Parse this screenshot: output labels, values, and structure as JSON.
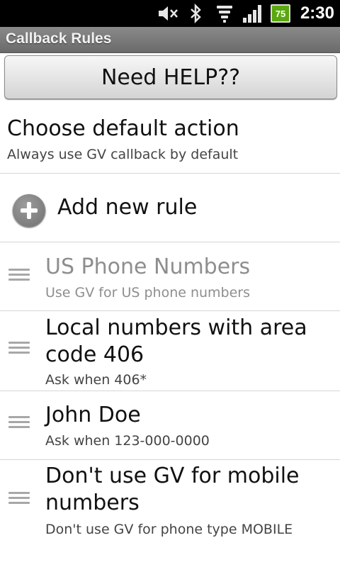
{
  "status_bar": {
    "icons": [
      "mute-icon",
      "bluetooth-icon",
      "wifi-icon",
      "signal-icon"
    ],
    "battery_level": "75",
    "time": "2:30"
  },
  "app": {
    "title": "Callback Rules"
  },
  "help_button": {
    "label": "Need HELP??"
  },
  "default_action": {
    "title": "Choose default action",
    "summary": "Always use GV callback by default"
  },
  "add_rule": {
    "label": "Add new rule",
    "icon": "add-circle-icon"
  },
  "rules": [
    {
      "title": "US Phone Numbers",
      "summary": "Use GV for US phone numbers",
      "enabled": false
    },
    {
      "title": "Local numbers with area code 406",
      "summary": "Ask when 406*",
      "enabled": true
    },
    {
      "title": "John Doe",
      "summary": "Ask when 123-000-0000",
      "enabled": true
    },
    {
      "title": "Don't use GV for mobile numbers",
      "summary": "Don't use GV for phone type MOBILE",
      "enabled": true
    }
  ],
  "colors": {
    "title_bar": "#7a7a7a",
    "battery": "#5aa70f",
    "disabled_text": "#8e8e8e"
  }
}
